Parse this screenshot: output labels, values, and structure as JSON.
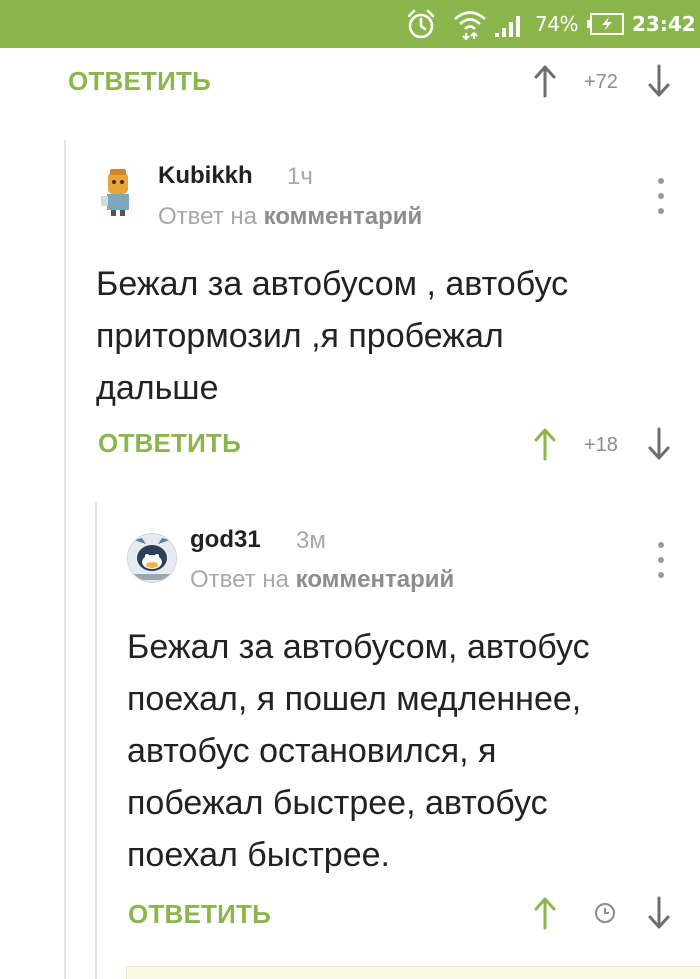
{
  "status_bar": {
    "battery_percent": "74%",
    "time": "23:42",
    "icons": [
      "alarm-icon",
      "wifi-icon",
      "signal-icon",
      "battery-charging-icon"
    ]
  },
  "top_actions": {
    "reply_label": "ОТВЕТИТЬ",
    "rating": "+72"
  },
  "comments": [
    {
      "username": "Kubikkh",
      "time": "1ч",
      "reply_to_prefix": "Ответ на",
      "reply_to_target": "комментарий",
      "text_lines": [
        "Бежал за автобусом , автобус",
        "притормозил ,я пробежал",
        "дальше"
      ],
      "reply_label": "ОТВЕТИТЬ",
      "rating": "+18"
    },
    {
      "username": "god31",
      "time": "3м",
      "reply_to_prefix": "Ответ на",
      "reply_to_target": "комментарий",
      "text_lines": [
        "Бежал за автобусом, автобус",
        "поехал, я пошел медленнее,",
        "автобус остановился, я",
        "побежал быстрее, автобус",
        "поехал быстрее."
      ],
      "reply_label": "ОТВЕТИТЬ",
      "rating_icon": "clock-icon"
    }
  ],
  "colors": {
    "accent": "#8ab64b",
    "status_bar_bg": "#8ab64b",
    "text": "#222222",
    "muted": "#a8a8a8",
    "thread_line": "#e4e4e4"
  }
}
